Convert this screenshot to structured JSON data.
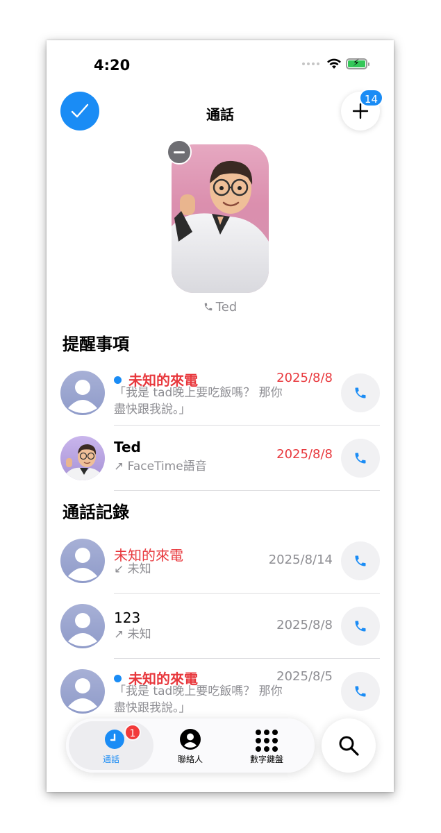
{
  "status_bar": {
    "time": "4:20"
  },
  "nav": {
    "title": "通話",
    "add_badge": "14"
  },
  "favorite": {
    "name": "Ted"
  },
  "sections": {
    "reminders": "提醒事項",
    "recents": "通話記錄"
  },
  "reminders": [
    {
      "name": "未知的來電",
      "date": "2025/8/8",
      "detail_line1": "「我是 tad晚上要吃飯嗎？ 那你",
      "detail_line2": "盡快跟我說。」"
    },
    {
      "name": "Ted",
      "date": "2025/8/8",
      "detail": "↗ FaceTime語音"
    }
  ],
  "recents": [
    {
      "name": "未知的來電",
      "date": "2025/8/14",
      "detail": "↙ 未知"
    },
    {
      "name": "123",
      "date": "2025/8/8",
      "detail": "↗ 未知"
    },
    {
      "name": "未知的來電",
      "date": "2025/8/5",
      "detail_line1": "「我是 tad晚上要吃飯嗎？ 那你",
      "detail_line2": "盡快跟我說。」"
    }
  ],
  "tabbar": {
    "calls": "通話",
    "calls_badge": "1",
    "contacts": "聯絡人",
    "keypad": "數字鍵盤"
  },
  "colors": {
    "accent": "#1a8cf5",
    "missed": "#e8383d",
    "secondary": "#8e8e93",
    "favorite_bg": "#db8fae"
  },
  "icons": [
    "checkmark-icon",
    "plus-icon",
    "minus-icon",
    "phone-icon",
    "person-icon",
    "clock-icon",
    "keypad-icon",
    "search-icon"
  ]
}
